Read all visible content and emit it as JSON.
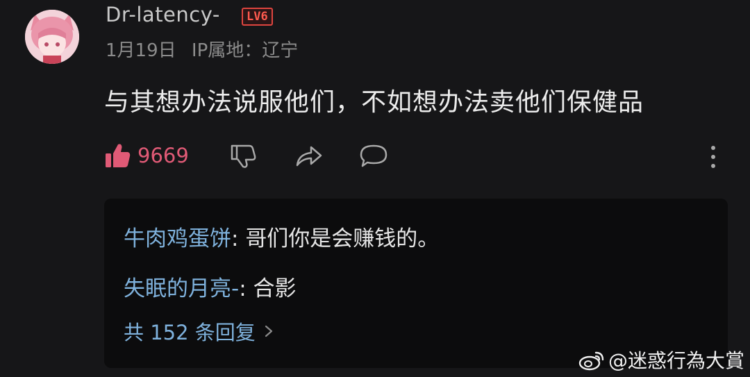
{
  "comment": {
    "username": "Dr-latency-",
    "level": "LV6",
    "date": "1月19日",
    "ip_location": "IP属地：辽宁",
    "text": "与其想办法说服他们，不如想办法卖他们保健品",
    "like_count": "9669"
  },
  "replies": [
    {
      "user": "牛肉鸡蛋饼",
      "separator": ": ",
      "text": "哥们你是会赚钱的。"
    },
    {
      "user": "失眠的月亮-",
      "separator": ": ",
      "text": "合影"
    }
  ],
  "reply_summary": "共 152 条回复",
  "watermark": "@迷惑行為大賞",
  "colors": {
    "background": "#161618",
    "like": "#e05a76",
    "link": "#7fb2dd",
    "level_badge": "#e0453f"
  },
  "icons": [
    "avatar",
    "thumbs-up-icon",
    "thumbs-down-icon",
    "share-icon",
    "comment-icon",
    "more-vertical-icon",
    "chevron-right-icon",
    "weibo-logo-icon"
  ]
}
